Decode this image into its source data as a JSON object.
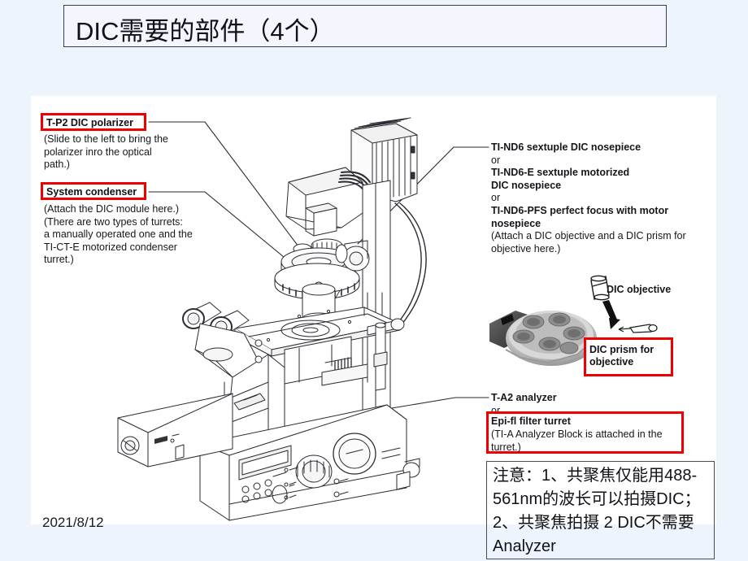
{
  "slide": {
    "title": "DIC需要的部件（4个）",
    "date": "2021/8/12",
    "background_color": "#eef4fc",
    "panel_color": "#ffffff",
    "accent_color": "#ee0000"
  },
  "annotations": {
    "polarizer_label": "T-P2 DIC polarizer",
    "polarizer_note": "(Slide to the left to bring the\npolarizer inro the optical\npath.)",
    "condenser_label": "System condenser",
    "condenser_note": "(Attach the DIC module here.)\n(There are two types of turrets:\na manually operated one and the\nTI-CT-E motorized condenser\nturret.)",
    "nosepiece_line1": "TI-ND6 sextuple DIC nosepiece",
    "nosepiece_or1": "or",
    "nosepiece_line2": "TI-ND6-E sextuple motorized\nDIC nosepiece",
    "nosepiece_or2": "or",
    "nosepiece_line3": "TI-ND6-PFS perfect focus with motor\nnosepiece",
    "nosepiece_note": "(Attach a DIC objective and a DIC prism for\nobjective here.)",
    "dic_objective_label": "DIC objective",
    "dic_prism_label": "DIC prism for\nobjective",
    "analyzer_label": "T-A2 analyzer",
    "analyzer_or": "or",
    "epifl_label": "Epi-fl filter turret",
    "epifl_note": "(TI-A Analyzer Block is attached in the\nturret.)"
  },
  "note": {
    "text": "注意：1、共聚焦仅能用488-561nm的波长可以拍摄DIC；2、共聚焦拍摄 2 DIC不需要Analyzer"
  },
  "illustration": {
    "caption": "inverted-microscope-line-drawing",
    "photo_caption": "dic-nosepiece-photo"
  }
}
